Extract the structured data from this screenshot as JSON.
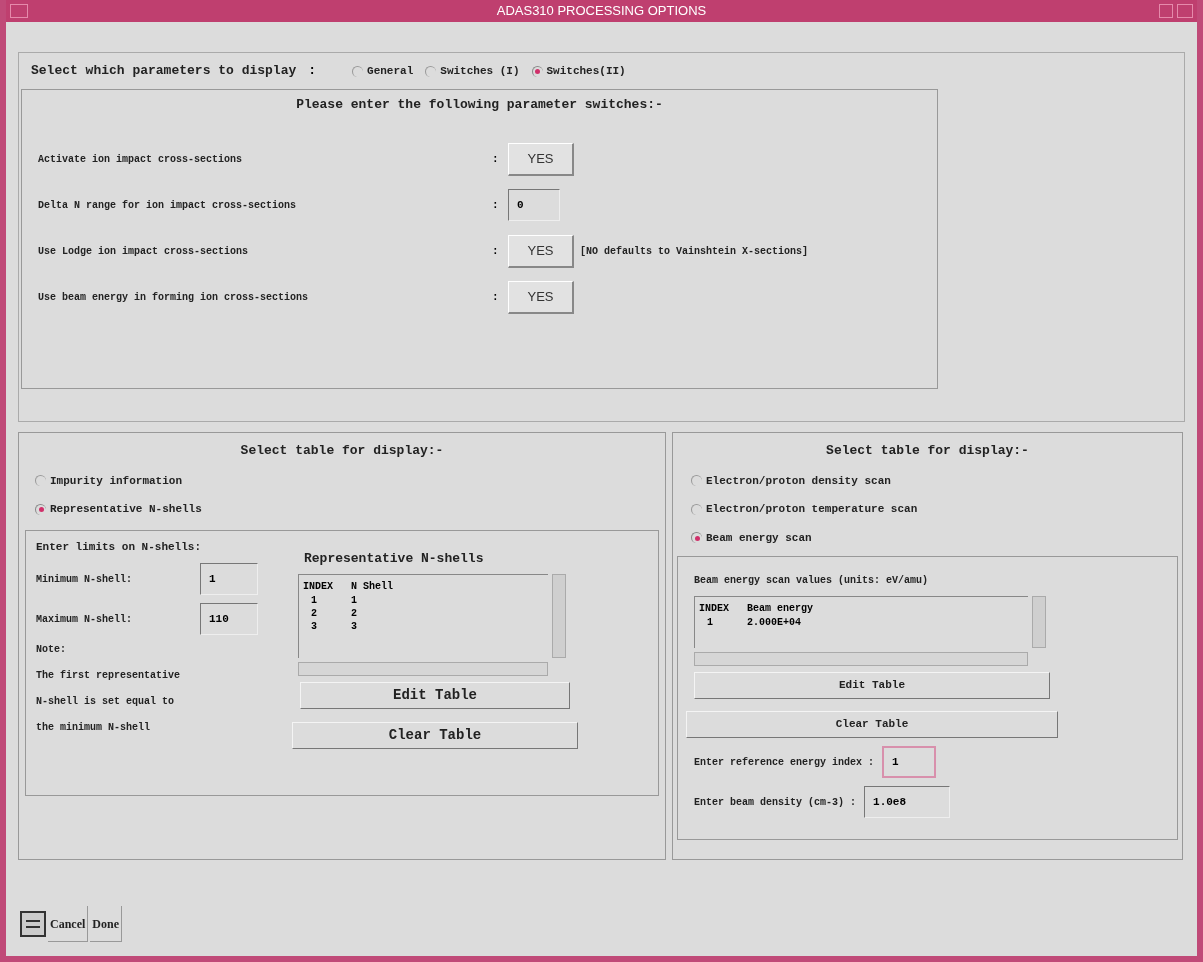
{
  "window": {
    "title": "ADAS310 PROCESSING OPTIONS"
  },
  "display_select": {
    "label": "Select which parameters to display",
    "separator": ":",
    "options": [
      {
        "label": "General",
        "selected": false
      },
      {
        "label": "Switches (I)",
        "selected": false
      },
      {
        "label": "Switches(II)",
        "selected": true
      }
    ]
  },
  "switches_panel": {
    "heading": "Please enter the following parameter switches:-",
    "rows": [
      {
        "kind": "button",
        "label": "Activate ion impact cross-sections",
        "separator": ":",
        "value": "YES"
      },
      {
        "kind": "field",
        "label": "Delta N range for ion impact cross-sections",
        "separator": ":",
        "value": "0"
      },
      {
        "kind": "button",
        "label": "Use Lodge ion impact cross-sections",
        "separator": ":",
        "value": "YES",
        "note": "[NO defaults to Vainshtein X-sections]"
      },
      {
        "kind": "button",
        "label": "Use beam energy in forming ion cross-sections",
        "separator": ":",
        "value": "YES"
      }
    ]
  },
  "left_panel": {
    "heading": "Select table for display:-",
    "options": [
      {
        "label": "Impurity information",
        "selected": false
      },
      {
        "label": "Representative N-shells",
        "selected": true
      }
    ],
    "limits": {
      "heading": "Enter limits on N-shells:",
      "fields": [
        {
          "label": "Minimum N-shell:",
          "value": "1"
        },
        {
          "label": "Maximum N-shell:",
          "value": "110"
        }
      ],
      "note_lines": [
        "Note:",
        "The first representative",
        "N-shell is set equal to",
        "the minimum N-shell"
      ]
    },
    "table": {
      "title": "Representative N-shells",
      "columns": [
        "INDEX",
        "N Shell"
      ],
      "rows": [
        [
          "1",
          "1"
        ],
        [
          "2",
          "2"
        ],
        [
          "3",
          "3"
        ]
      ]
    },
    "buttons": [
      "Edit Table",
      "Clear Table"
    ]
  },
  "right_panel": {
    "heading": "Select table for display:-",
    "options": [
      {
        "label": "Electron/proton density scan",
        "selected": false
      },
      {
        "label": "Electron/proton temperature scan",
        "selected": false
      },
      {
        "label": "Beam energy scan",
        "selected": true
      }
    ],
    "table": {
      "title": "Beam energy scan values (units: eV/amu)",
      "columns": [
        "INDEX",
        "Beam energy"
      ],
      "rows": [
        [
          "1",
          "2.000E+04"
        ]
      ]
    },
    "buttons": [
      "Edit Table",
      "Clear Table"
    ],
    "fields": [
      {
        "label": "Enter reference energy index :",
        "value": "1",
        "focused": true
      },
      {
        "label": "Enter beam density (cm-3) :",
        "value": "1.0e8",
        "focused": false
      }
    ]
  },
  "footer": {
    "buttons": [
      "Cancel",
      "Done"
    ]
  }
}
